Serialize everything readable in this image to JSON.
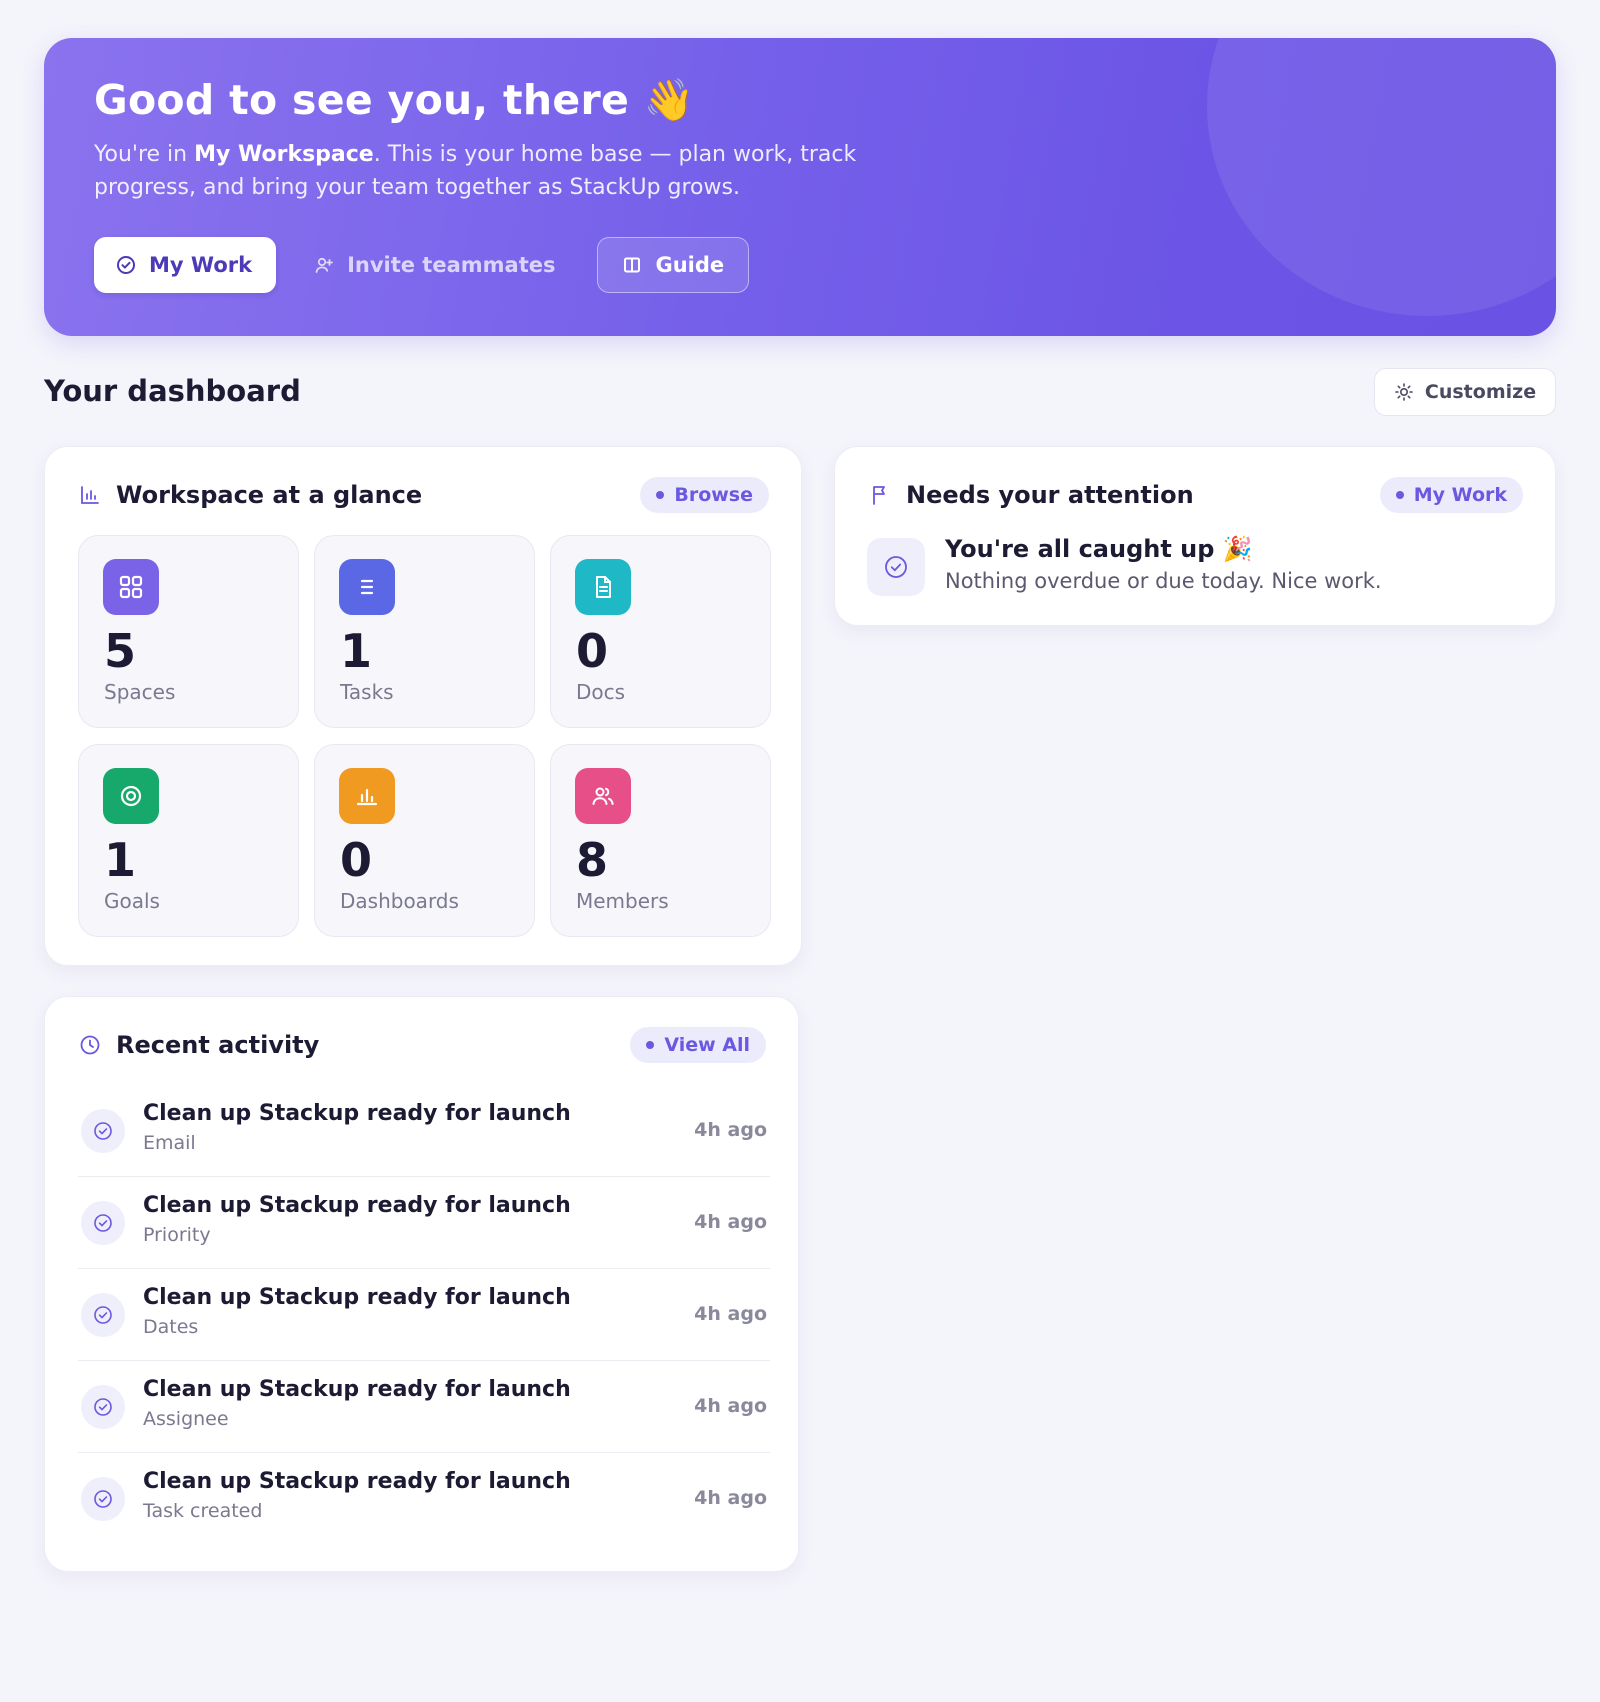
{
  "hero": {
    "title": "Good to see you, there 👋",
    "subtitle_pre": "You're in ",
    "workspace_name": "My Workspace",
    "subtitle_post": ". This is your home base — plan work, track progress, and bring your team together as StackUp grows.",
    "buttons": {
      "my_work": "My Work",
      "invite": "Invite teammates",
      "guide": "Guide"
    }
  },
  "dashboard": {
    "title": "Your dashboard",
    "customize_label": "Customize"
  },
  "glance": {
    "title": "Workspace at a glance",
    "action": "Browse",
    "stats": [
      {
        "value": "5",
        "label": "Spaces",
        "color": "#7b63e8",
        "icon": "grid-icon"
      },
      {
        "value": "1",
        "label": "Tasks",
        "color": "#5b68e6",
        "icon": "list-icon"
      },
      {
        "value": "0",
        "label": "Docs",
        "color": "#1fb8c6",
        "icon": "document-icon"
      },
      {
        "value": "1",
        "label": "Goals",
        "color": "#17a86b",
        "icon": "target-icon"
      },
      {
        "value": "0",
        "label": "Dashboards",
        "color": "#f09a22",
        "icon": "bar-chart-icon"
      },
      {
        "value": "8",
        "label": "Members",
        "color": "#e64f88",
        "icon": "users-icon"
      }
    ]
  },
  "attention": {
    "title": "Needs your attention",
    "action": "My Work",
    "empty_title": "You're all caught up 🎉",
    "empty_sub": "Nothing overdue or due today. Nice work."
  },
  "activity": {
    "title": "Recent activity",
    "action": "View All",
    "items": [
      {
        "title": "Clean up Stackup ready for launch",
        "sub": "Email",
        "time": "4h ago"
      },
      {
        "title": "Clean up Stackup ready for launch",
        "sub": "Priority",
        "time": "4h ago"
      },
      {
        "title": "Clean up Stackup ready for launch",
        "sub": "Dates",
        "time": "4h ago"
      },
      {
        "title": "Clean up Stackup ready for launch",
        "sub": "Assignee",
        "time": "4h ago"
      },
      {
        "title": "Clean up Stackup ready for launch",
        "sub": "Task created",
        "time": "4h ago"
      }
    ]
  },
  "colors": {
    "accent": "#6a58e0",
    "hero_start": "#8b73ee",
    "hero_end": "#6a52e4",
    "background": "#f4f4fb"
  }
}
